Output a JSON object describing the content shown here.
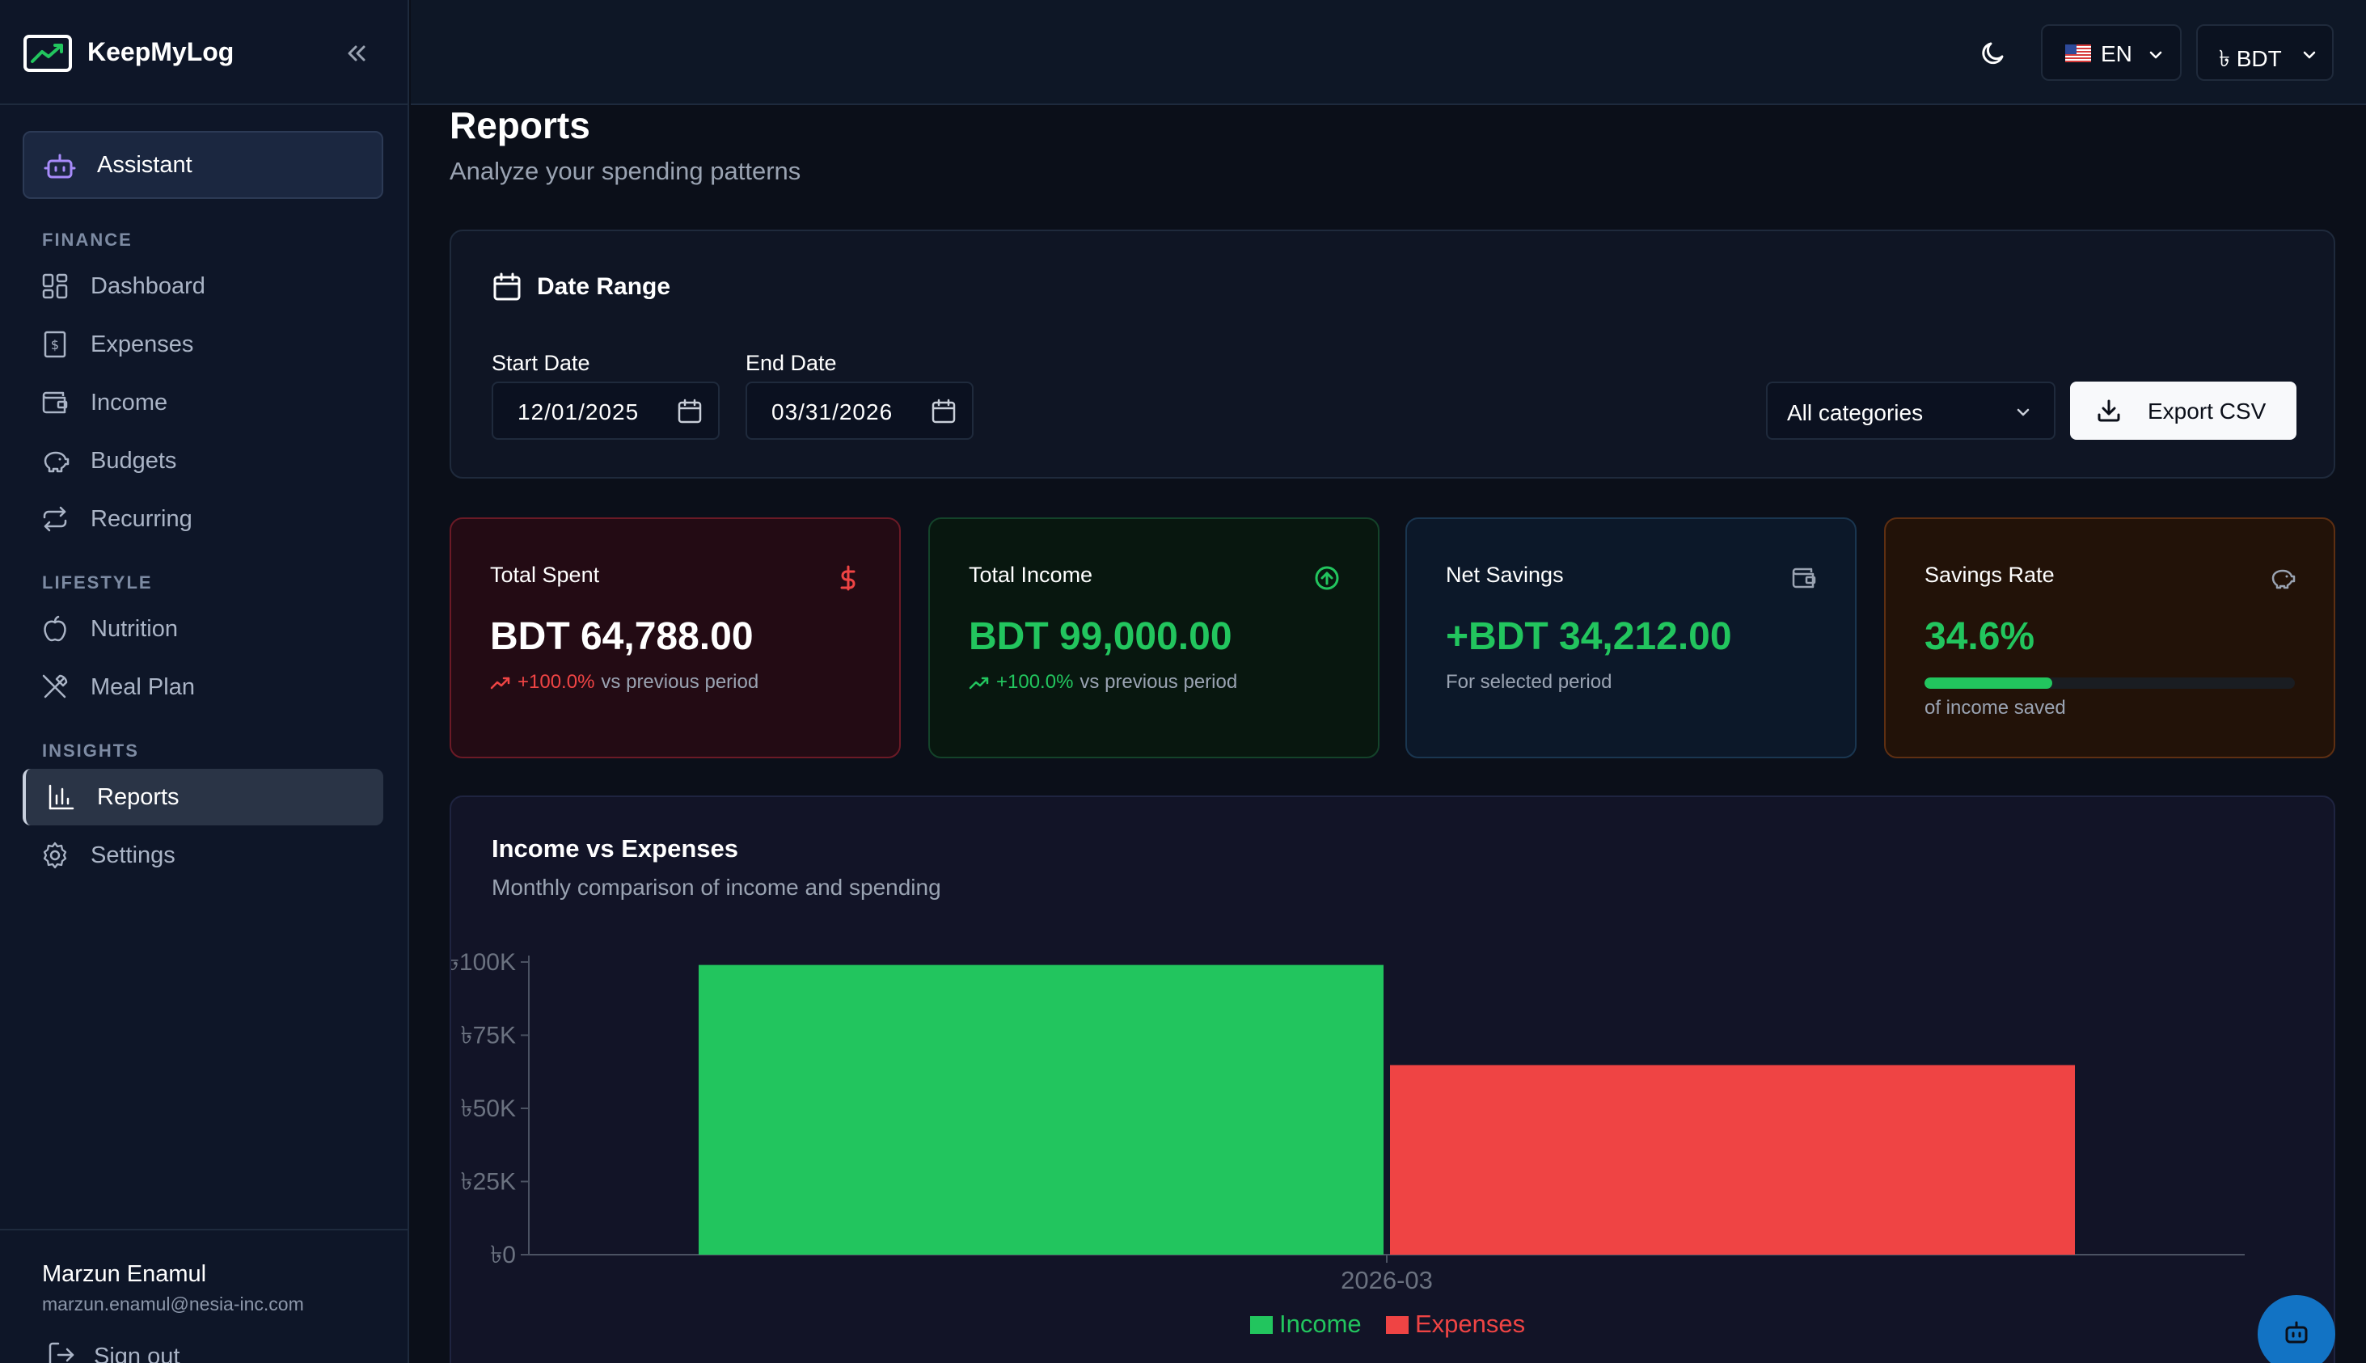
{
  "app": {
    "name": "KeepMyLog"
  },
  "sidebar": {
    "assistant_label": "Assistant",
    "sections": {
      "finance": "FINANCE",
      "lifestyle": "LIFESTYLE",
      "insights": "INSIGHTS"
    },
    "items": [
      {
        "label": "Dashboard",
        "icon": "dashboard-icon"
      },
      {
        "label": "Expenses",
        "icon": "receipt-icon"
      },
      {
        "label": "Income",
        "icon": "wallet-icon"
      },
      {
        "label": "Budgets",
        "icon": "piggy-bank-icon"
      },
      {
        "label": "Recurring",
        "icon": "repeat-icon"
      },
      {
        "label": "Nutrition",
        "icon": "apple-icon"
      },
      {
        "label": "Meal Plan",
        "icon": "utensils-icon"
      },
      {
        "label": "Reports",
        "icon": "bar-chart-icon",
        "active": true
      },
      {
        "label": "Settings",
        "icon": "gear-icon"
      }
    ],
    "user": {
      "name": "Marzun Enamul",
      "email": "marzun.enamul@nesia-inc.com",
      "signout_label": "Sign out"
    }
  },
  "topbar": {
    "language": "EN",
    "currency": "৳ BDT"
  },
  "page": {
    "title": "Reports",
    "subtitle": "Analyze your spending patterns"
  },
  "date_range": {
    "title": "Date Range",
    "start_label": "Start Date",
    "start_value": "12/01/2025",
    "end_label": "End Date",
    "end_value": "03/31/2026",
    "category_value": "All categories",
    "export_label": "Export CSV"
  },
  "stats": {
    "spent": {
      "title": "Total Spent",
      "value": "BDT 64,788.00",
      "change": "+100.0%",
      "suffix": "vs previous period"
    },
    "income": {
      "title": "Total Income",
      "value": "BDT 99,000.00",
      "change": "+100.0%",
      "suffix": "vs previous period"
    },
    "net": {
      "title": "Net Savings",
      "value": "+BDT 34,212.00",
      "sub": "For selected period"
    },
    "rate": {
      "title": "Savings Rate",
      "value": "34.6%",
      "percent": 34.6,
      "sub": "of income saved"
    }
  },
  "colors": {
    "income": "#22c55e",
    "expenses": "#ef4444",
    "spent_accent": "#ef4444",
    "income_accent": "#22c55e",
    "net_accent": "#22c55e",
    "rate_accent": "#22c55e"
  },
  "chart": {
    "title": "Income vs Expenses",
    "subtitle": "Monthly comparison of income and spending"
  },
  "chart_data": {
    "type": "bar",
    "categories": [
      "2026-03"
    ],
    "series": [
      {
        "name": "Income",
        "values": [
          99000
        ],
        "color": "#22c55e"
      },
      {
        "name": "Expenses",
        "values": [
          64788
        ],
        "color": "#ef4444"
      }
    ],
    "y_ticks": [
      0,
      25000,
      50000,
      75000,
      100000
    ],
    "y_tick_labels": [
      "৳0",
      "৳25K",
      "৳50K",
      "৳75K",
      "৳100K"
    ],
    "ylim": [
      0,
      100000
    ],
    "legend": "bottom",
    "grid": false
  }
}
